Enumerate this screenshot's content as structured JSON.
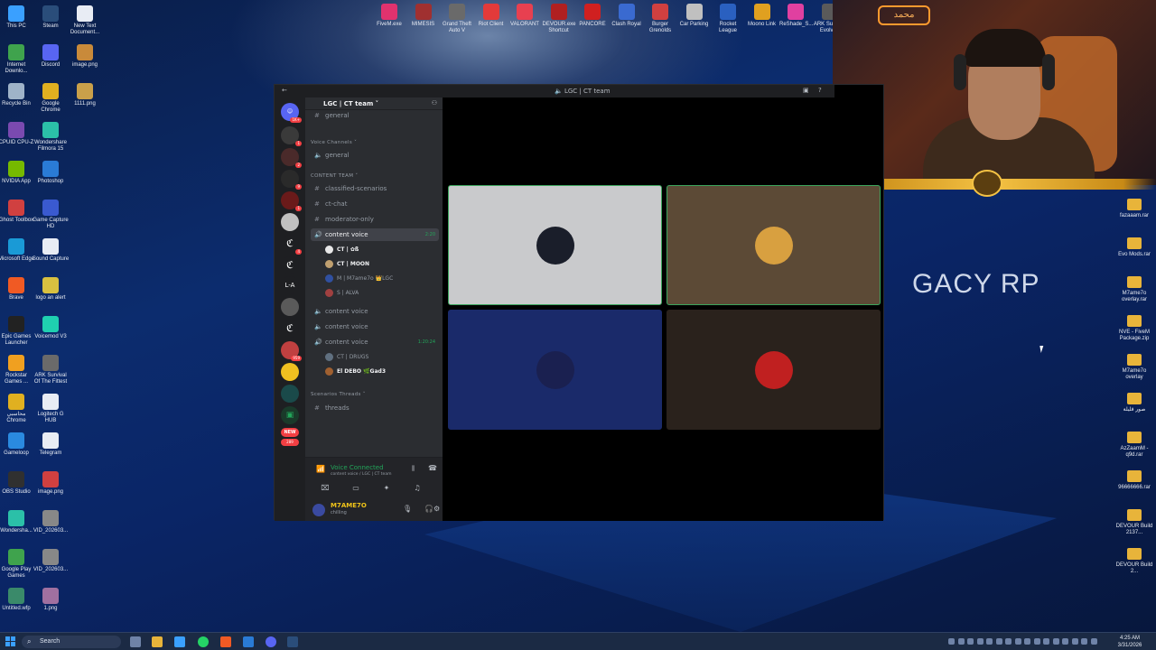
{
  "desktop": {
    "left_icons": [
      {
        "label": "This PC",
        "color": "#3aa0ff"
      },
      {
        "label": "Steam",
        "color": "#2a4d7a"
      },
      {
        "label": "New Text Document...",
        "color": "#e8ecf4"
      },
      {
        "label": "Internet Downlo...",
        "color": "#3fa34d"
      },
      {
        "label": "Discord",
        "color": "#5865f2"
      },
      {
        "label": "image.png",
        "color": "#c98a3a"
      },
      {
        "label": "Recycle Bin",
        "color": "#9fb3c8"
      },
      {
        "label": "Google Chrome",
        "color": "#e0b020"
      },
      {
        "label": "1111.png",
        "color": "#c9a04a"
      },
      {
        "label": "CPUID CPU-Z",
        "color": "#7a4ab0"
      },
      {
        "label": "Wondershare Filmora 15",
        "color": "#2bc0a8"
      },
      {
        "label": "NVIDIA App",
        "color": "#76b900"
      },
      {
        "label": "Photoshop",
        "color": "#2a7bd6"
      },
      {
        "label": "Ghost Toolbox",
        "color": "#d04040"
      },
      {
        "label": "Game Capture HD",
        "color": "#3a5ad0"
      },
      {
        "label": "Microsoft Edge",
        "color": "#1a9ad6"
      },
      {
        "label": "Sound Capture",
        "color": "#e8ecf4"
      },
      {
        "label": "Brave",
        "color": "#f05a24"
      },
      {
        "label": "logo an alert",
        "color": "#d8c040"
      },
      {
        "label": "Epic Games Launcher",
        "color": "#222222"
      },
      {
        "label": "Voicemod V3",
        "color": "#1fd0b0"
      },
      {
        "label": "Rockstar Games ...",
        "color": "#f0a020"
      },
      {
        "label": "ARK Survival Of The Fittest",
        "color": "#6a6a6a"
      },
      {
        "label": "محاسبي Chrome",
        "color": "#e0b020"
      },
      {
        "label": "Logitech G HUB",
        "color": "#e8ecf4"
      },
      {
        "label": "Gameloop",
        "color": "#2a8ae0"
      },
      {
        "label": "Telegram",
        "color": "#e8ecf4"
      },
      {
        "label": "OBS Studio",
        "color": "#303030"
      },
      {
        "label": "image.png",
        "color": "#d04040"
      },
      {
        "label": "Wondersha...",
        "color": "#2bc0a8"
      },
      {
        "label": "VID_202603...",
        "color": "#888888"
      },
      {
        "label": "Google Play Games",
        "color": "#3fa34d"
      },
      {
        "label": "VID_202603...",
        "color": "#888888"
      },
      {
        "label": "Untitled.wfp",
        "color": "#3a8a6a"
      },
      {
        "label": "1.png",
        "color": "#a070a0"
      }
    ],
    "top_icons": [
      {
        "label": "FiveM.exe",
        "color": "#e0326e"
      },
      {
        "label": "MIMESIS",
        "color": "#a03030"
      },
      {
        "label": "Grand Theft Auto V",
        "color": "#6a6a6a"
      },
      {
        "label": "Riot Client",
        "color": "#e23a3a"
      },
      {
        "label": "VALORANT",
        "color": "#e84050"
      },
      {
        "label": "DEVOUR.exe Shortcut",
        "color": "#b02020"
      },
      {
        "label": "PANCORE",
        "color": "#d02020"
      },
      {
        "label": "Clash Royal",
        "color": "#3a6ad0"
      },
      {
        "label": "Burger Grenolds",
        "color": "#d04040"
      },
      {
        "label": "Car Parking",
        "color": "#c0c0c0"
      },
      {
        "label": "Rocket League",
        "color": "#2a60c0"
      },
      {
        "label": "Moono Link",
        "color": "#e0a020"
      },
      {
        "label": "ReShade_S...",
        "color": "#e040a0"
      },
      {
        "label": "ARK Survival Evolved",
        "color": "#5a5a5a"
      }
    ],
    "right_icons": [
      {
        "label": "fazaaam.rar"
      },
      {
        "label": "Evo Mods.rar"
      },
      {
        "label": "M7ame7o overlay.rar"
      },
      {
        "label": "NVE - FiveM Package.zip"
      },
      {
        "label": "M7ame7o overlay"
      },
      {
        "label": "صور قليلة"
      },
      {
        "label": "AzZaamM - q9d.rar"
      },
      {
        "label": "96666666.rar"
      },
      {
        "label": "DEVOUR Build 2137..."
      },
      {
        "label": "DEVOUR Build 2..."
      }
    ],
    "wallpaper_text": "GACY RP",
    "stream_sign": "محمد"
  },
  "discord": {
    "window_title": "LGC | CT team",
    "guild_name": "LGC | CT team",
    "top_channel": "general",
    "categories": {
      "voice": "Voice Channels ˅",
      "content": "CONTENT TEAM ˅",
      "threads": "Scenarios Threads ˅"
    },
    "voice_general": "general",
    "text_channels": [
      "classified-scenarios",
      "ct-chat",
      "moderator-only"
    ],
    "selected_voice": {
      "name": "content voice",
      "time": "2:20"
    },
    "members_1": [
      {
        "name": "CT | ✿ß",
        "color": "#e8e8e8"
      },
      {
        "name": "CT | MOON",
        "color": "#c0a070"
      },
      {
        "name": "M | M7ame7o 👑LGC",
        "color": "#3050a0"
      },
      {
        "name": "S | ALVA",
        "color": "#a04040"
      }
    ],
    "voice_2": "content voice",
    "voice_3": "content voice",
    "voice_4": {
      "name": "content voice",
      "time": "1:20:24"
    },
    "members_2": [
      {
        "name": "CT | DRUGS",
        "color": "#607080"
      },
      {
        "name": "El DEBO 🌿Gad3",
        "color": "#a06030"
      }
    ],
    "threads_label": "threads",
    "voice_connected": {
      "status": "Voice Connected",
      "sub": "content voice / LGC | CT team"
    },
    "user": {
      "name": "M7AME7O",
      "status": "chilling"
    },
    "tiles": [
      {
        "bg": "#c9cacc",
        "avatar": "#1a1e2a",
        "border": "#3ba55c"
      },
      {
        "bg": "#5c4a36",
        "avatar": "#d8a040",
        "border": "#3ba55c"
      },
      {
        "bg": "#1a2a6a",
        "avatar": "#1a2050",
        "border": "#1a2a6a"
      },
      {
        "bg": "#2a221c",
        "avatar": "#c02020",
        "border": "#2a221c"
      }
    ],
    "rail_badges": [
      "1K+",
      "1",
      "2",
      "9",
      "1",
      "4",
      "18",
      "959",
      "289"
    ],
    "rail_text": {
      "la": "L-A",
      "new": "NEW"
    }
  },
  "taskbar": {
    "search_placeholder": "Search",
    "time": "4:25 AM",
    "date": "3/31/2026"
  }
}
